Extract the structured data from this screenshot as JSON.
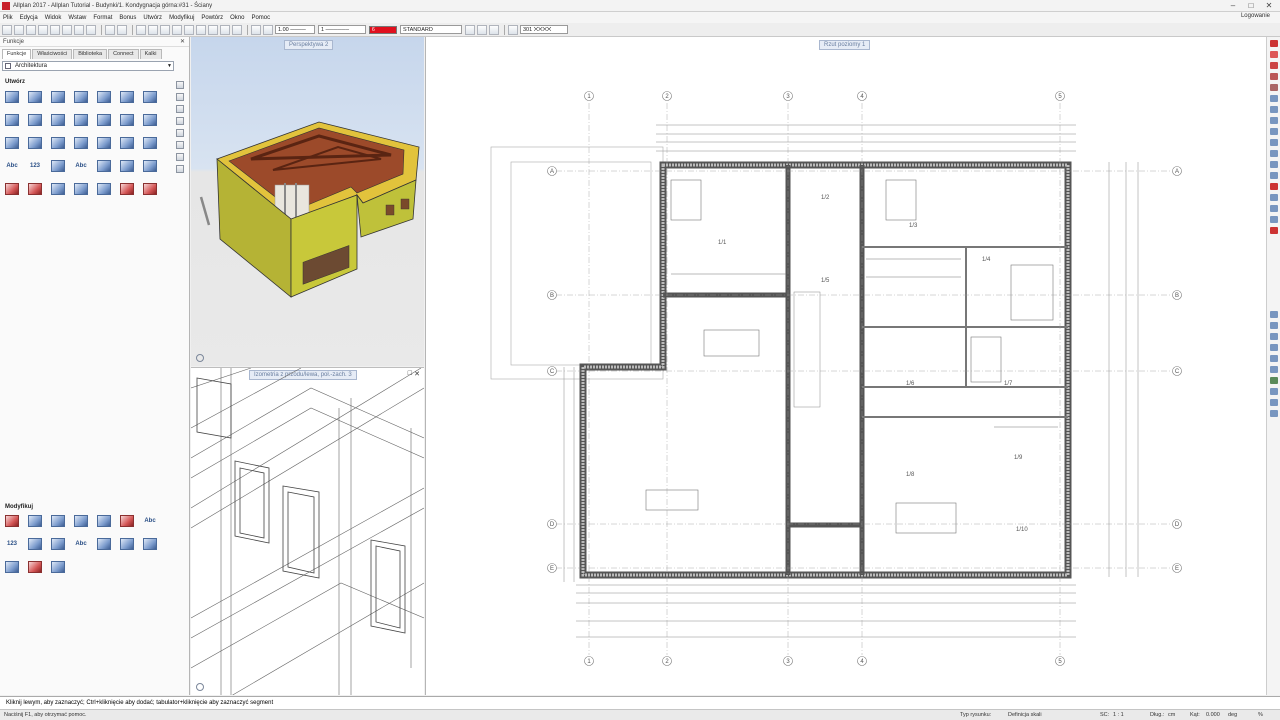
{
  "window": {
    "title": "Allplan 2017 - Allplan Tutorial - Budynki/1. Kondygnacja górna:#31 - Ściany",
    "controls": [
      "–",
      "□",
      "✕"
    ]
  },
  "menu": {
    "items": [
      "Plik",
      "Edycja",
      "Widok",
      "Wstaw",
      "Format",
      "Bonus",
      "Utwórz",
      "Modyfikuj",
      "Powtórz",
      "Okno",
      "Pomoc"
    ],
    "login": "Logowanie"
  },
  "toolbar": {
    "line_thickness": "1.00",
    "line_type": "1",
    "pen_color": "6",
    "pen_color_hex": "#e0101e",
    "style": "STANDARD",
    "hatch_number": "301"
  },
  "panel": {
    "title": "Funkcje",
    "tabs": [
      "Funkcje",
      "Właściwości",
      "Biblioteka",
      "Connect",
      "Kalki"
    ],
    "active_tab": "Funkcje",
    "family": "Architektura",
    "create_label": "Utwórz",
    "modify_label": "Modyfikuj",
    "create_text_buttons": [
      "Abc",
      "123",
      "Abc"
    ],
    "modify_text_buttons": [
      "Abc",
      "123",
      "Abc"
    ]
  },
  "views": {
    "perspective_label": "Perspektywa 2",
    "isometric_label": "Izometria z przodu/lewa, poł.-zach. 3",
    "plan_label": "Rzut poziomy 1"
  },
  "plan": {
    "grid_numbers": [
      "1",
      "2",
      "3",
      "4",
      "5"
    ],
    "grid_letters": [
      "A",
      "B",
      "C",
      "D",
      "E"
    ],
    "rooms": [
      "1/1",
      "1/2",
      "1/3",
      "1/4",
      "1/5",
      "1/6",
      "1/7",
      "1/8",
      "1/9",
      "1/10"
    ]
  },
  "command_line": "Kliknij lewym, aby zaznaczyć; Ctrl+kliknięcie aby dodać; tabulator+kliknięcie aby zaznaczyć segment",
  "status": {
    "help": "Naciśnij F1, aby otrzymać pomoc.",
    "drawing_type_label": "Typ rysunku:",
    "drawing_type": "Definicja skali",
    "scale_label": "SC:",
    "scale": "1 : 1",
    "length_label": "Dług.:",
    "length_unit": "cm",
    "angle_label": "Kąt:",
    "angle": "0.000",
    "angle_unit": "deg",
    "percent": "%"
  },
  "colors": {
    "accent_red": "#c8202a",
    "view_background": "#ffffff",
    "perspective_sky": "#c8d8ec",
    "wall_yellow": "#c8c83a",
    "brick": "#8c3a22"
  }
}
